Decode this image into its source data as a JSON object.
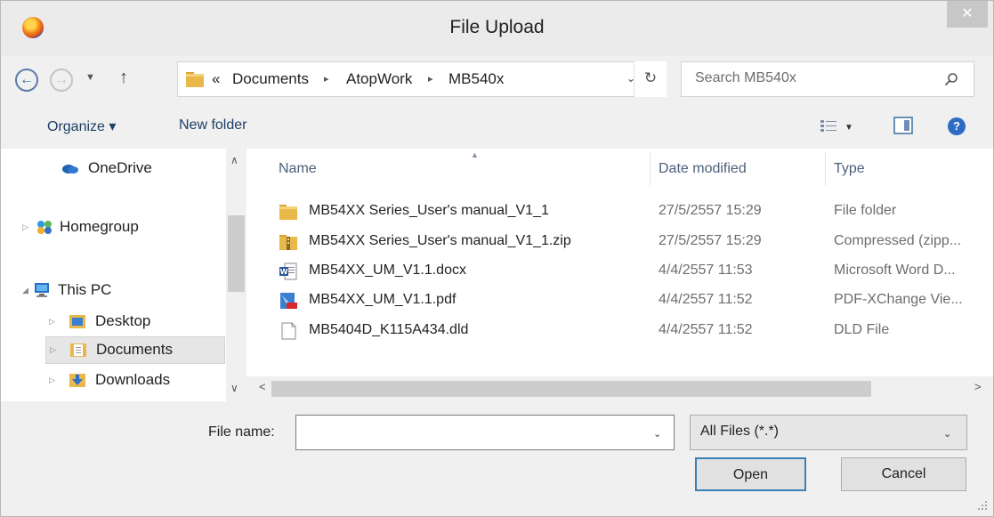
{
  "window": {
    "title": "File Upload",
    "close_glyph": "✕"
  },
  "nav": {
    "back_glyph": "←",
    "forward_glyph": "→",
    "recent_glyph": "▼",
    "up_glyph": "↑",
    "address": {
      "prefix": "«",
      "crumbs": [
        "Documents",
        "AtopWork",
        "MB540x"
      ],
      "separator": "▸",
      "dropdown_glyph": "⌄"
    },
    "refresh_glyph": "↻",
    "search_placeholder": "Search MB540x"
  },
  "toolbar": {
    "organize": "Organize ▾",
    "new_folder": "New folder",
    "view_drop": "▼",
    "help": "?"
  },
  "sidebar": {
    "items": [
      {
        "label": "OneDrive",
        "icon": "onedrive-icon"
      },
      {
        "label": "Homegroup",
        "icon": "homegroup-icon"
      },
      {
        "label": "This PC",
        "icon": "pc-icon"
      },
      {
        "label": "Desktop",
        "icon": "desktop-icon"
      },
      {
        "label": "Documents",
        "icon": "documents-icon"
      },
      {
        "label": "Downloads",
        "icon": "downloads-icon"
      }
    ],
    "selected": "Documents"
  },
  "columns": {
    "name": "Name",
    "date": "Date modified",
    "type": "Type"
  },
  "files": [
    {
      "name": "MB54XX Series_User's manual_V1_1",
      "date": "27/5/2557 15:29",
      "type": "File folder",
      "icon": "folder-icon"
    },
    {
      "name": "MB54XX Series_User's manual_V1_1.zip",
      "date": "27/5/2557 15:29",
      "type": "Compressed (zipp...",
      "icon": "zip-folder-icon"
    },
    {
      "name": "MB54XX_UM_V1.1.docx",
      "date": "4/4/2557 11:53",
      "type": "Microsoft Word D...",
      "icon": "word-doc-icon"
    },
    {
      "name": "MB54XX_UM_V1.1.pdf",
      "date": "4/4/2557 11:52",
      "type": "PDF-XChange Vie...",
      "icon": "pdf-icon"
    },
    {
      "name": "MB5404D_K115A434.dld",
      "date": "4/4/2557 11:52",
      "type": "DLD File",
      "icon": "blank-file-icon"
    }
  ],
  "bottom": {
    "file_name_label": "File name:",
    "file_name_value": "",
    "file_type": "All Files (*.*)",
    "open": "Open",
    "cancel": "Cancel",
    "dropdown_glyph": "⌄"
  },
  "colors": {
    "accent": "#3c7fb1",
    "folder": "#e8b84b",
    "link_text": "#1e3f66"
  }
}
